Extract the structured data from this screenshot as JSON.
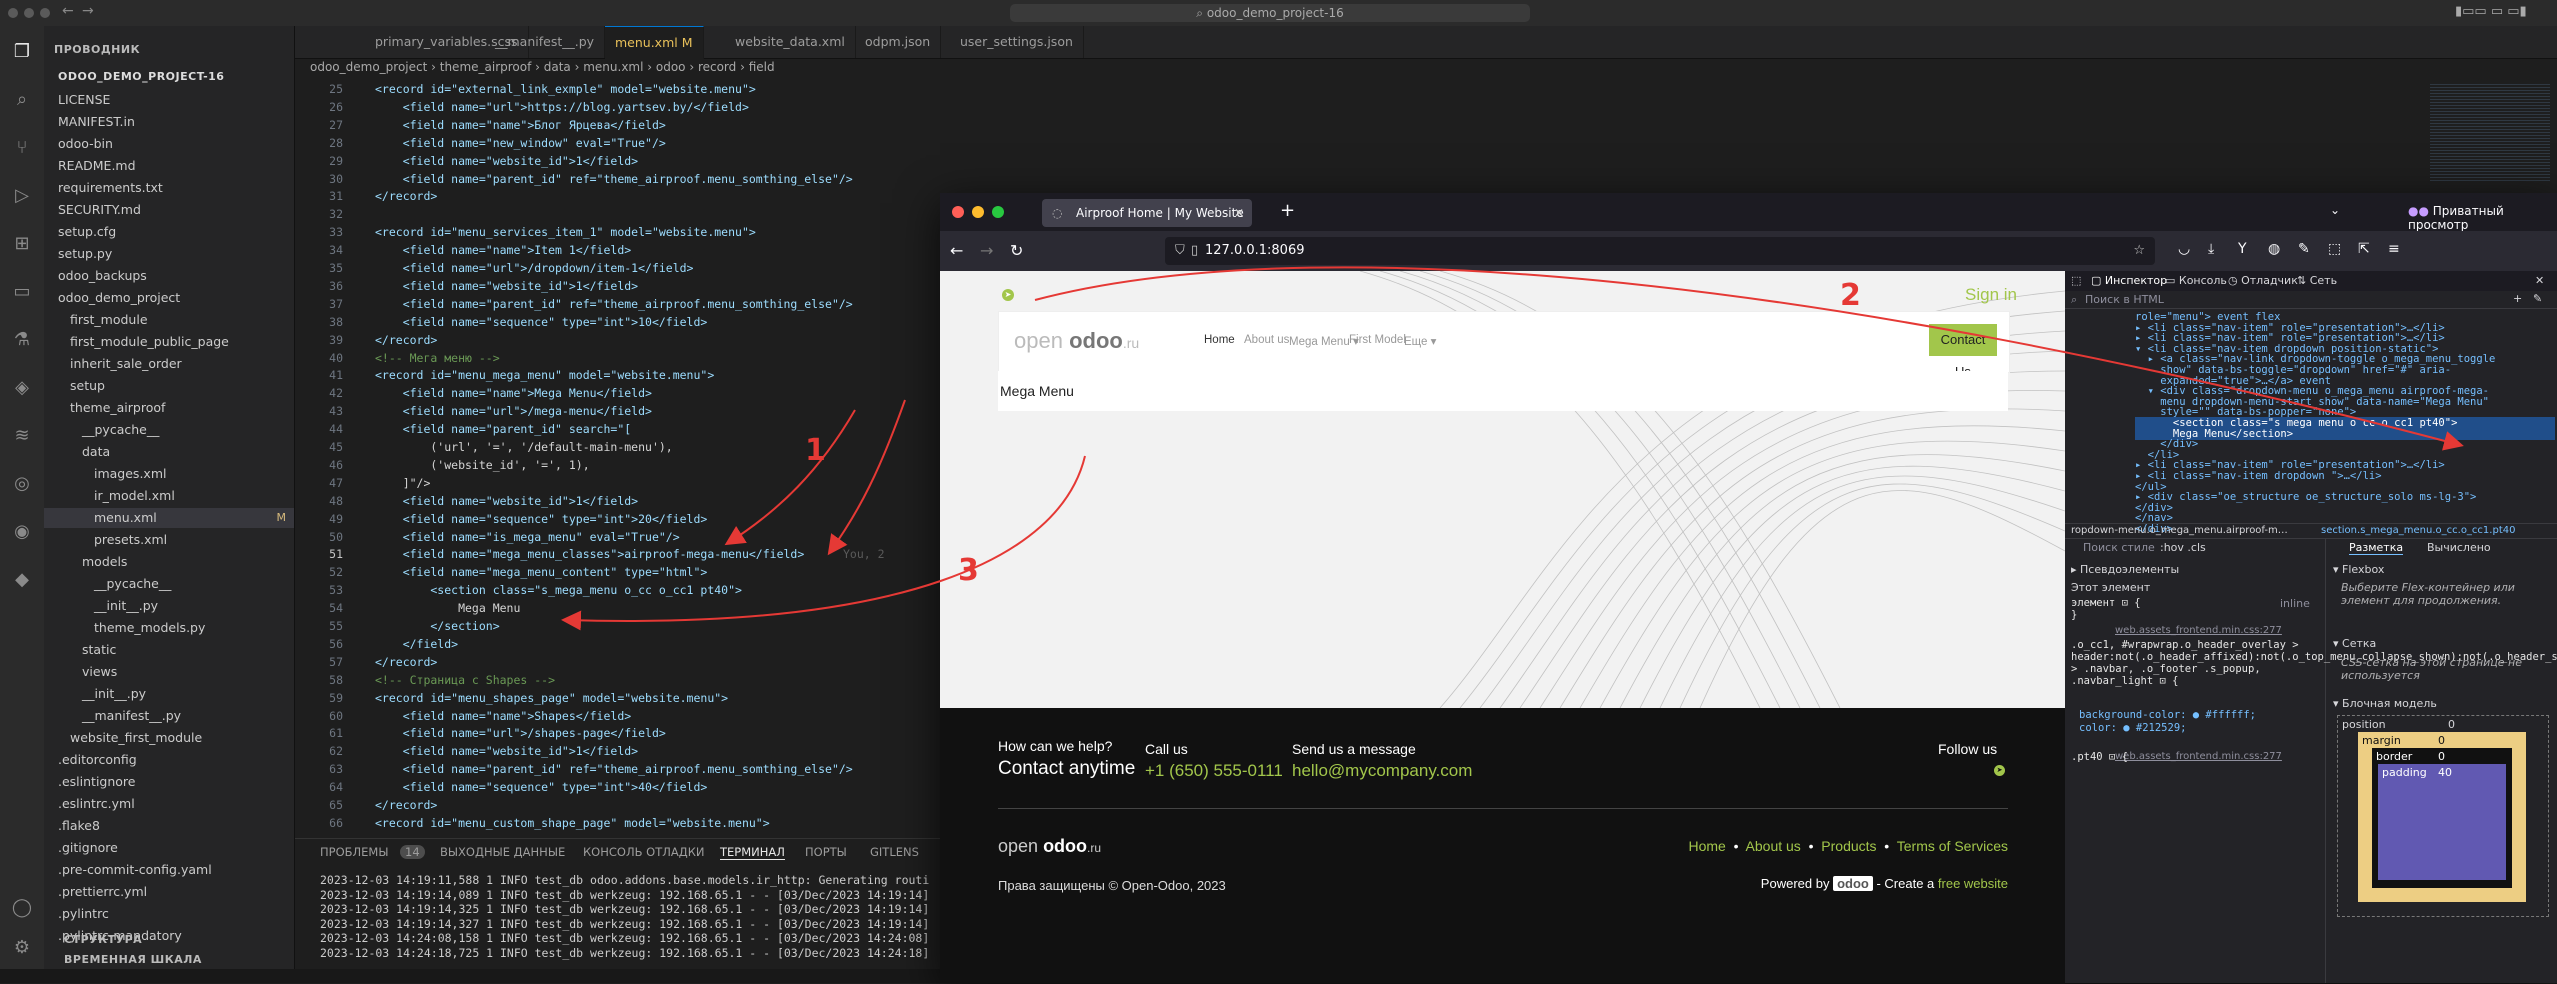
{
  "titlebar": {
    "command_center": "odoo_demo_project-16"
  },
  "explorer": {
    "header": "ПРОВОДНИК",
    "project": "ODOO_DEMO_PROJECT-16",
    "items": [
      {
        "label": "LICENSE",
        "indent": 0
      },
      {
        "label": "MANIFEST.in",
        "indent": 0
      },
      {
        "label": "odoo-bin",
        "indent": 0
      },
      {
        "label": "README.md",
        "indent": 0
      },
      {
        "label": "requirements.txt",
        "indent": 0
      },
      {
        "label": "SECURITY.md",
        "indent": 0
      },
      {
        "label": "setup.cfg",
        "indent": 0
      },
      {
        "label": "setup.py",
        "indent": 0
      },
      {
        "label": "odoo_backups",
        "indent": 0
      },
      {
        "label": "odoo_demo_project",
        "indent": 0
      },
      {
        "label": "first_module",
        "indent": 1
      },
      {
        "label": "first_module_public_page",
        "indent": 1
      },
      {
        "label": "inherit_sale_order",
        "indent": 1
      },
      {
        "label": "setup",
        "indent": 1
      },
      {
        "label": "theme_airproof",
        "indent": 1
      },
      {
        "label": "__pycache__",
        "indent": 2
      },
      {
        "label": "data",
        "indent": 2
      },
      {
        "label": "images.xml",
        "indent": 3
      },
      {
        "label": "ir_model.xml",
        "indent": 3
      },
      {
        "label": "menu.xml",
        "indent": 3
      },
      {
        "label": "presets.xml",
        "indent": 3
      },
      {
        "label": "models",
        "indent": 2
      },
      {
        "label": "__pycache__",
        "indent": 3
      },
      {
        "label": "__init__.py",
        "indent": 3
      },
      {
        "label": "theme_models.py",
        "indent": 3
      },
      {
        "label": "static",
        "indent": 2
      },
      {
        "label": "views",
        "indent": 2
      },
      {
        "label": "__init__.py",
        "indent": 2
      },
      {
        "label": "__manifest__.py",
        "indent": 2
      },
      {
        "label": "website_first_module",
        "indent": 1
      },
      {
        "label": ".editorconfig",
        "indent": 0
      },
      {
        "label": ".eslintignore",
        "indent": 0
      },
      {
        "label": ".eslintrc.yml",
        "indent": 0
      },
      {
        "label": ".flake8",
        "indent": 0
      },
      {
        "label": ".gitignore",
        "indent": 0
      },
      {
        "label": ".pre-commit-config.yaml",
        "indent": 0
      },
      {
        "label": ".prettierrc.yml",
        "indent": 0
      },
      {
        "label": ".pylintrc",
        "indent": 0
      },
      {
        "label": ".pylintrc-mandatory",
        "indent": 0
      }
    ],
    "modified_marker": "M",
    "outline": "СТРУКТУРА",
    "timeline": "ВРЕМЕННАЯ ШКАЛА"
  },
  "tabs": [
    {
      "label": "primary_variables.scss"
    },
    {
      "label": "__manifest__.py"
    },
    {
      "label": "menu.xml M"
    },
    {
      "label": "website_data.xml"
    },
    {
      "label": "odpm.json"
    },
    {
      "label": "user_settings.json"
    }
  ],
  "breadcrumb": "odoo_demo_project  ›  theme_airproof  ›  data  ›  menu.xml  ›  odoo  ›  record  ›  field",
  "code": {
    "line_numbers": [
      "25",
      "26",
      "27",
      "28",
      "29",
      "30",
      "31",
      "32",
      "33",
      "34",
      "35",
      "36",
      "37",
      "38",
      "39",
      "40",
      "41",
      "42",
      "43",
      "44",
      "45",
      "46",
      "47",
      "48",
      "49",
      "50",
      "51",
      "52",
      "53",
      "54",
      "55",
      "56",
      "57",
      "58",
      "59",
      "60",
      "61",
      "62",
      "63",
      "64",
      "65",
      "66"
    ],
    "lines": [
      "<record id=\"external_link_exmple\" model=\"website.menu\">",
      "    <field name=\"url\">https://blog.yartsev.by/</field>",
      "    <field name=\"name\">Блог Ярцева</field>",
      "    <field name=\"new_window\" eval=\"True\"/>",
      "    <field name=\"website_id\">1</field>",
      "    <field name=\"parent_id\" ref=\"theme_airproof.menu_somthing_else\"/>",
      "</record>",
      "",
      "<record id=\"menu_services_item_1\" model=\"website.menu\">",
      "    <field name=\"name\">Item 1</field>",
      "    <field name=\"url\">/dropdown/item-1</field>",
      "    <field name=\"website_id\">1</field>",
      "    <field name=\"parent_id\" ref=\"theme_airproof.menu_somthing_else\"/>",
      "    <field name=\"sequence\" type=\"int\">10</field>",
      "</record>",
      "<!-- Мега меню -->",
      "<record id=\"menu_mega_menu\" model=\"website.menu\">",
      "    <field name=\"name\">Mega Menu</field>",
      "    <field name=\"url\">/mega-menu</field>",
      "    <field name=\"parent_id\" search=\"[",
      "        ('url', '=', '/default-main-menu'),",
      "        ('website_id', '=', 1),",
      "    ]\"/>",
      "    <field name=\"website_id\">1</field>",
      "    <field name=\"sequence\" type=\"int\">20</field>",
      "    <field name=\"is_mega_menu\" eval=\"True\"/>",
      "    <field name=\"mega_menu_classes\">airproof-mega-menu</field>",
      "    <field name=\"mega_menu_content\" type=\"html\">",
      "        <section class=\"s_mega_menu o_cc o_cc1 pt40\">",
      "            Mega Menu",
      "        </section>",
      "    </field>",
      "</record>",
      "<!-- Страница с Shapes -->",
      "<record id=\"menu_shapes_page\" model=\"website.menu\">",
      "    <field name=\"name\">Shapes</field>",
      "    <field name=\"url\">/shapes-page</field>",
      "    <field name=\"website_id\">1</field>",
      "    <field name=\"parent_id\" ref=\"theme_airproof.menu_somthing_else\"/>",
      "    <field name=\"sequence\" type=\"int\">40</field>",
      "</record>",
      "<record id=\"menu_custom_shape_page\" model=\"website.menu\">"
    ],
    "blame": "You, 2"
  },
  "panel": {
    "tabs": [
      {
        "label": "ПРОБЛЕМЫ"
      },
      {
        "label": "14"
      },
      {
        "label": "ВЫХОДНЫЕ ДАННЫЕ"
      },
      {
        "label": "КОНСОЛЬ ОТЛАДКИ"
      },
      {
        "label": "ТЕРМИНАЛ"
      },
      {
        "label": "ПОРТЫ"
      },
      {
        "label": "GITLENS"
      }
    ],
    "terminal": [
      "2023-12-03 14:19:11,588 1 INFO test_db odoo.addons.base.models.ir_http: Generating routi",
      "2023-12-03 14:19:14,089 1 INFO test_db werkzeug: 192.168.65.1 - - [03/Dec/2023 14:19:14]",
      "2023-12-03 14:19:14,325 1 INFO test_db werkzeug: 192.168.65.1 - - [03/Dec/2023 14:19:14]",
      "2023-12-03 14:19:14,327 1 INFO test_db werkzeug: 192.168.65.1 - - [03/Dec/2023 14:19:14]",
      "2023-12-03 14:24:08,158 1 INFO test_db werkzeug: 192.168.65.1 - - [03/Dec/2023 14:24:08]",
      "2023-12-03 14:24:18,725 1 INFO test_db werkzeug: 192.168.65.1 - - [03/Dec/2023 14:24:18]"
    ]
  },
  "browser": {
    "tab_title": "Airproof Home | My Website",
    "url": "127.0.0.1:8069",
    "private_label": "Приватный просмотр",
    "site": {
      "sign_in": "Sign in",
      "logo_open": "open",
      "logo_odoo": "odoo",
      "logo_ru": ".ru",
      "nav": [
        "Home",
        "About us",
        "Mega Menu",
        "First Model",
        "Еще"
      ],
      "contact_us": "Contact Us",
      "mega_menu_text": "Mega Menu",
      "footer": {
        "help_q": "How can we help?",
        "help_cta": "Contact anytime",
        "call_us": "Call us",
        "phone": "+1 (650) 555-0111",
        "send_msg": "Send us a message",
        "email": "hello@mycompany.com",
        "follow": "Follow us",
        "links": [
          "Home",
          "About us",
          "Products",
          "Terms of Services"
        ],
        "copyright": "Права защищены © Open-Odoo, 2023",
        "powered_prefix": "Powered by",
        "powered_brand": "odoo",
        "powered_mid": "- Create a",
        "powered_link": "free website"
      }
    },
    "devtools": {
      "tabs": [
        "Инспектор",
        "Консоль",
        "Отладчик",
        "Сеть"
      ],
      "search_placeholder": "Поиск в HTML",
      "html_lines": [
        "role=\"menu\"> event flex",
        "▸ <li class=\"nav-item\" role=\"presentation\">…</li>",
        "▸ <li class=\"nav-item\" role=\"presentation\">…</li>",
        "▾ <li class=\"nav-item dropdown position-static\">",
        "  ▸ <a class=\"nav-link dropdown-toggle o_mega_menu_toggle",
        "    show\" data-bs-toggle=\"dropdown\" href=\"#\" aria-",
        "    expanded=\"true\">…</a> event",
        "  ▾ <div class=\"dropdown-menu o_mega_menu airproof-mega-",
        "    menu dropdown-menu-start show\" data-name=\"Mega Menu\"",
        "    style=\"\" data-bs-popper=\"none\">",
        "      <section class=\"s_mega_menu o_cc o_cc1 pt40\">",
        "      Mega Menu</section>",
        "    </div>",
        "  </li>",
        "▸ <li class=\"nav-item\" role=\"presentation\">…</li>",
        "▸ <li class=\"nav-item dropdown \">…</li>",
        "</ul>",
        "▸ <div class=\"oe_structure oe_structure_solo ms-lg-3\">",
        "</div>",
        "</nav>",
        "</div>"
      ],
      "breadcrumb_left": "ropdown-menu.o_mega_menu.airproof-m…",
      "breadcrumb_right": "section.s_mega_menu.o_cc.o_cc1.pt40",
      "styles_filter": "Поиск стиле",
      "styles_toggles": ":hov .cls",
      "pseudo": "Псевдоэлементы",
      "this_el": "Этот элемент",
      "element_rule": "элемент ⊡ {",
      "inline": "inline",
      "close_brace": "}",
      "css_src1": "web.assets_frontend.min.css:277",
      "css_rule1": ".o_cc1, #wrapwrap.o_header_overlay > header:not(.o_header_affixed):not(.o_top_menu_collapse_shown):not(.o_header_sidebar) > .navbar, .o_footer .s_popup, .navbar_light ⊡ {",
      "css_bg": "background-color: ● #ffffff;",
      "css_color": "color: ● #212529;",
      "css_src2": "web.assets_frontend.min.css:277",
      "css_rule2": ".pt40 ⊡ {",
      "layout_tabs": [
        "Разметка",
        "Вычислено"
      ],
      "flexbox": "Flexbox",
      "flexbox_hint": "Выберите Flex-контейнер или элемент для продолжения.",
      "grid": "Сетка",
      "grid_hint": "CSS-сетка на этой странице не используется",
      "boxmodel": "Блочная модель",
      "position": "position",
      "position_val": "0",
      "margin": "margin",
      "margin_val": "0",
      "border": "border",
      "border_val": "0",
      "padding": "padding",
      "padding_val": "40"
    }
  },
  "annotations": [
    "1",
    "2",
    "3"
  ],
  "colors": {
    "accent_green": "#a2c64b",
    "annotation_red": "#e53935",
    "vscode_bg": "#1e1e1e"
  }
}
